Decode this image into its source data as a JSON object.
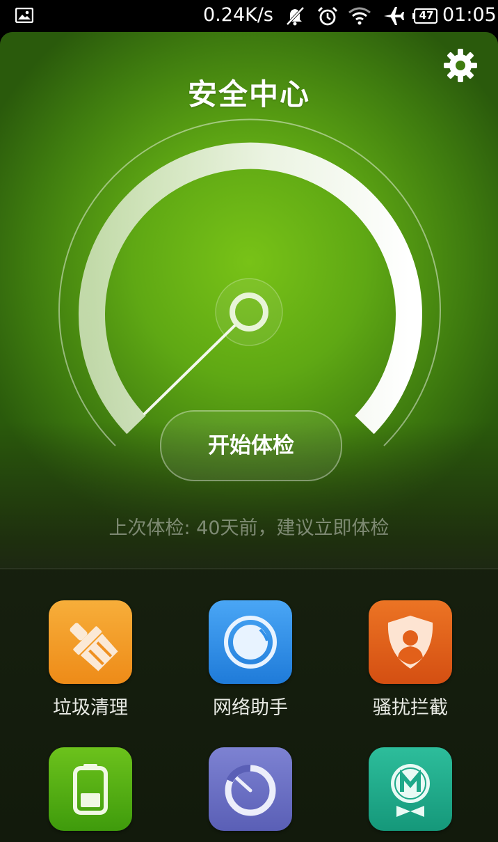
{
  "status_bar": {
    "speed": "0.24K/s",
    "battery": "47",
    "time": "01:05"
  },
  "header": {
    "title": "安全中心",
    "settings_icon": "gear-icon"
  },
  "scan": {
    "button_label": "开始体检",
    "last_check_text": "上次体检: 40天前，建议立即体检"
  },
  "colors": {
    "hero_green": "#6db515",
    "accent_orange": "#f29a22",
    "accent_blue": "#2f8ee8",
    "accent_red_orange": "#e2601a",
    "accent_green": "#52b012",
    "accent_purple": "#6a6fc4",
    "accent_teal": "#1fa98a"
  },
  "tools": [
    {
      "label": "垃圾清理",
      "icon": "broom-icon",
      "color": "#f29a22"
    },
    {
      "label": "网络助手",
      "icon": "network-ring-icon",
      "color": "#2f8ee8"
    },
    {
      "label": "骚扰拦截",
      "icon": "shield-user-icon",
      "color": "#e2601a"
    },
    {
      "label": "",
      "icon": "battery-icon",
      "color": "#52b012"
    },
    {
      "label": "",
      "icon": "speedometer-icon",
      "color": "#6a6fc4"
    },
    {
      "label": "",
      "icon": "m-badge-icon",
      "color": "#1fa98a"
    }
  ]
}
